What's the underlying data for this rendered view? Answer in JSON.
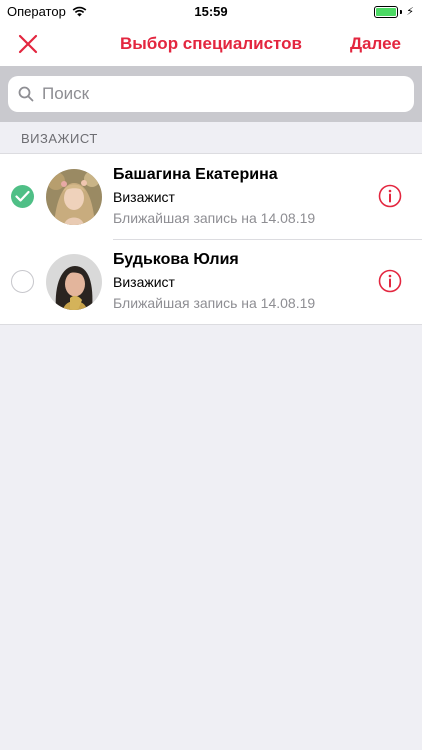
{
  "status": {
    "carrier": "Оператор",
    "time": "15:59"
  },
  "nav": {
    "title": "Выбор специалистов",
    "next_label": "Далее"
  },
  "search": {
    "placeholder": "Поиск"
  },
  "section": {
    "title": "ВИЗАЖИСТ"
  },
  "specialists": [
    {
      "name": "Башагина Екатерина",
      "role": "Визажист",
      "next_slot": "Ближайшая запись на 14.08.19",
      "selected": true
    },
    {
      "name": "Будькова Юлия",
      "role": "Визажист",
      "next_slot": "Ближайшая запись на 14.08.19",
      "selected": false
    }
  ],
  "colors": {
    "accent": "#e3263f",
    "check": "#4fbf86"
  },
  "icons": {
    "close": "close-icon",
    "search": "search-icon",
    "info": "info-icon",
    "check": "checkmark-icon"
  }
}
